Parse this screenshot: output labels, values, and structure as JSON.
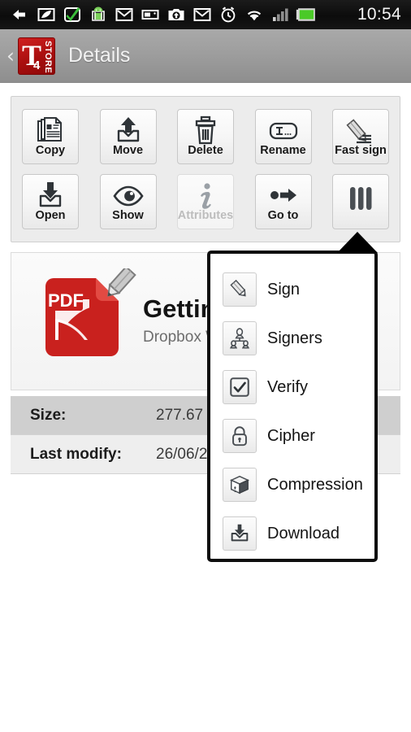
{
  "status_bar": {
    "time": "10:54",
    "icons": [
      {
        "name": "back-arrow-icon"
      },
      {
        "name": "leaf-note-icon"
      },
      {
        "name": "checkmark-note-icon"
      },
      {
        "name": "android-robot-icon"
      },
      {
        "name": "gmail-icon"
      },
      {
        "name": "sd-card-icon"
      },
      {
        "name": "camera-upload-icon"
      },
      {
        "name": "gmail-icon-2"
      },
      {
        "name": "alarm-clock-icon"
      },
      {
        "name": "wifi-icon"
      },
      {
        "name": "cell-signal-icon"
      },
      {
        "name": "battery-icon"
      }
    ]
  },
  "action_bar": {
    "back_label": "‹",
    "logo_letter": "T",
    "logo_digit": "4",
    "logo_word": "STORE",
    "title": "Details"
  },
  "toolbar": {
    "row1": [
      {
        "label": "Copy",
        "icon": "copy-icon",
        "disabled": false
      },
      {
        "label": "Move",
        "icon": "move-icon",
        "disabled": false
      },
      {
        "label": "Delete",
        "icon": "trash-icon",
        "disabled": false
      },
      {
        "label": "Rename",
        "icon": "rename-icon",
        "disabled": false
      },
      {
        "label": "Fast sign",
        "icon": "fast-sign-icon",
        "disabled": false
      }
    ],
    "row2": [
      {
        "label": "Open",
        "icon": "open-icon",
        "disabled": false
      },
      {
        "label": "Show",
        "icon": "eye-icon",
        "disabled": false
      },
      {
        "label": "Attributes",
        "icon": "info-icon",
        "disabled": true
      },
      {
        "label": "Go to",
        "icon": "goto-arrow-icon",
        "disabled": false
      },
      {
        "label": "",
        "icon": "more-bars-icon",
        "disabled": false
      }
    ]
  },
  "file_card": {
    "icon": "pdf-file-signed-icon",
    "badge_text": "PDF",
    "name": "Getting",
    "subtitle": "Dropbox W"
  },
  "details": [
    {
      "key": "Size:",
      "value": "277.67 KB"
    },
    {
      "key": "Last modify:",
      "value": "26/06/20"
    }
  ],
  "popup_menu": {
    "items": [
      {
        "label": "Sign",
        "icon": "pencil-icon"
      },
      {
        "label": "Signers",
        "icon": "signers-group-icon"
      },
      {
        "label": "Verify",
        "icon": "checkbox-checked-icon"
      },
      {
        "label": "Cipher",
        "icon": "lock-icon"
      },
      {
        "label": "Compression",
        "icon": "package-box-icon"
      },
      {
        "label": "Download",
        "icon": "download-tray-icon"
      }
    ]
  },
  "colors": {
    "accent_red": "#c01818",
    "action_bar": "#9d9d9d",
    "panel_bg": "#ececec",
    "row_shade": "#cfcfcf"
  }
}
